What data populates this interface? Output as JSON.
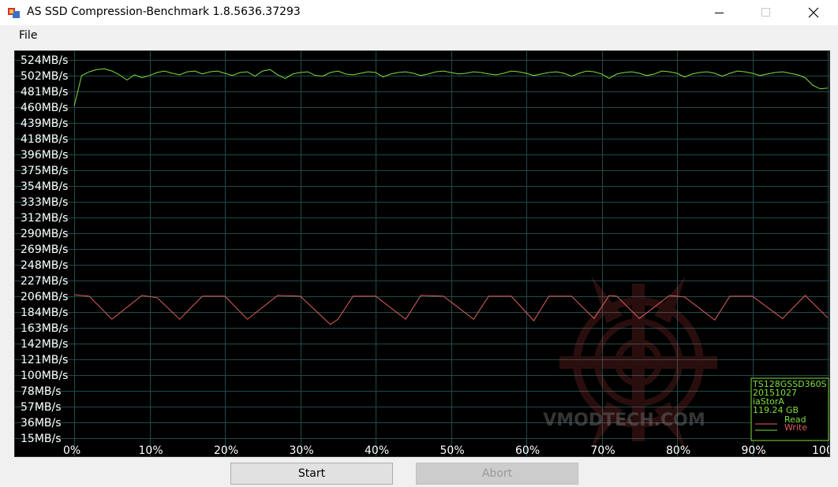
{
  "window": {
    "title": "AS SSD Compression-Benchmark 1.8.5636.37293",
    "menu": [
      "File"
    ]
  },
  "chart_data": {
    "type": "line",
    "y_tick_labels": [
      "524MB/s",
      "502MB/s",
      "481MB/s",
      "460MB/s",
      "439MB/s",
      "418MB/s",
      "396MB/s",
      "375MB/s",
      "354MB/s",
      "333MB/s",
      "312MB/s",
      "290MB/s",
      "269MB/s",
      "248MB/s",
      "227MB/s",
      "206MB/s",
      "184MB/s",
      "163MB/s",
      "142MB/s",
      "121MB/s",
      "100MB/s",
      "78MB/s",
      "57MB/s",
      "36MB/s",
      "15MB/s"
    ],
    "x_tick_labels": [
      "0%",
      "10%",
      "20%",
      "30%",
      "40%",
      "50%",
      "60%",
      "70%",
      "80%",
      "90%",
      "100%"
    ],
    "xlim": [
      0,
      100
    ],
    "ylim": [
      10,
      530
    ],
    "grid": true,
    "series": [
      {
        "name": "Read",
        "color": "#e06060",
        "x": [
          0,
          2,
          5,
          9,
          11,
          14,
          17,
          20,
          23,
          27,
          30,
          34,
          35,
          37,
          40,
          44,
          46,
          49,
          53,
          55,
          58,
          61,
          63,
          66,
          69,
          71,
          72,
          75,
          79,
          81,
          85,
          87,
          90,
          94,
          97,
          100
        ],
        "y": [
          208,
          206,
          175,
          207,
          204,
          175,
          206,
          206,
          175,
          207,
          206,
          168,
          175,
          206,
          206,
          175,
          207,
          206,
          175,
          206,
          206,
          173,
          206,
          206,
          176,
          207,
          206,
          176,
          207,
          205,
          174,
          206,
          206,
          176,
          207,
          177
        ]
      },
      {
        "name": "Write",
        "color": "#7ee03c",
        "x": [
          0,
          1,
          2,
          3,
          4,
          5,
          6,
          7,
          8,
          9,
          10,
          11,
          12,
          13,
          14,
          15,
          16,
          17,
          18,
          19,
          20,
          21,
          22,
          23,
          24,
          25,
          26,
          27,
          28,
          29,
          30,
          31,
          32,
          33,
          34,
          35,
          36,
          37,
          38,
          39,
          40,
          41,
          42,
          43,
          44,
          45,
          46,
          47,
          48,
          49,
          50,
          51,
          52,
          53,
          54,
          55,
          56,
          57,
          58,
          59,
          60,
          61,
          62,
          63,
          64,
          65,
          66,
          67,
          68,
          69,
          70,
          71,
          72,
          73,
          74,
          75,
          76,
          77,
          78,
          79,
          80,
          81,
          82,
          83,
          84,
          85,
          86,
          87,
          88,
          89,
          90,
          91,
          92,
          93,
          94,
          95,
          96,
          97,
          98,
          99,
          100
        ],
        "y": [
          462,
          503,
          508,
          511,
          512,
          509,
          504,
          497,
          504,
          500,
          503,
          507,
          509,
          506,
          504,
          508,
          509,
          505,
          508,
          509,
          506,
          503,
          507,
          508,
          502,
          509,
          511,
          504,
          499,
          505,
          507,
          508,
          503,
          502,
          507,
          509,
          505,
          504,
          506,
          508,
          507,
          501,
          505,
          507,
          508,
          506,
          503,
          505,
          508,
          509,
          507,
          505,
          506,
          508,
          507,
          505,
          504,
          506,
          509,
          508,
          506,
          503,
          505,
          507,
          508,
          506,
          502,
          506,
          509,
          508,
          505,
          499,
          505,
          507,
          508,
          506,
          503,
          505,
          509,
          508,
          506,
          501,
          505,
          507,
          508,
          506,
          502,
          506,
          509,
          508,
          506,
          503,
          505,
          507,
          508,
          506,
          504,
          500,
          490,
          485,
          486
        ]
      }
    ]
  },
  "legend": {
    "lines": [
      "TS128GSSD360S",
      "20151027",
      "iaStorA",
      "119.24 GB"
    ],
    "read_label": "Read",
    "write_label": "Write"
  },
  "watermark": "VMODTECH.COM",
  "buttons": {
    "start": "Start",
    "abort": "Abort"
  },
  "colors": {
    "read": "#e06060",
    "write": "#7ee03c",
    "grid": "#1f4a4a",
    "axis_text": "#ffffff",
    "legend_text": "#7ee03c"
  }
}
